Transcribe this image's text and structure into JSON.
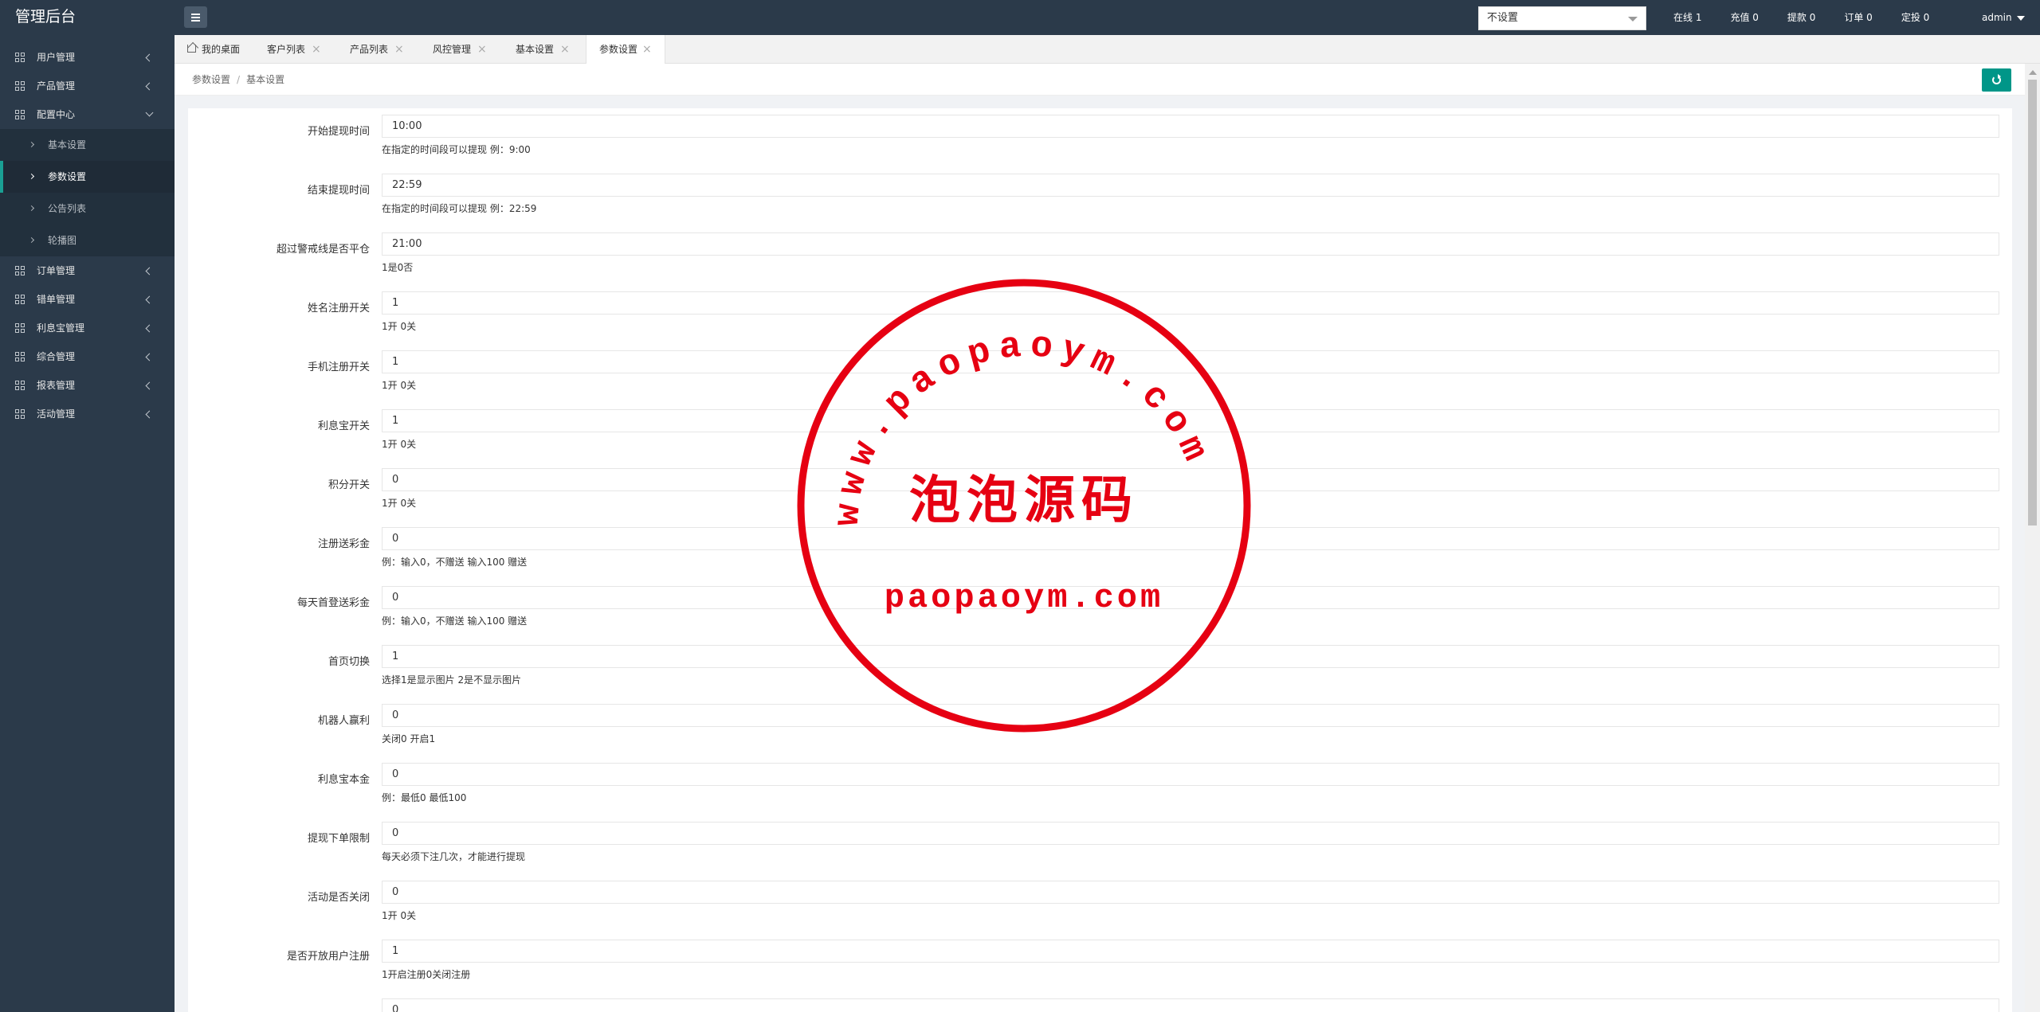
{
  "app": {
    "title": "管理后台"
  },
  "header": {
    "theme_select": {
      "value": "不设置"
    },
    "stats": [
      {
        "label": "在线 1"
      },
      {
        "label": "充值 0"
      },
      {
        "label": "提款 0"
      },
      {
        "label": "订单 0"
      },
      {
        "label": "定投 0"
      }
    ],
    "user": "admin"
  },
  "sidebar": {
    "items": [
      {
        "label": "用户管理"
      },
      {
        "label": "产品管理"
      },
      {
        "label": "配置中心"
      },
      {
        "label": "订单管理"
      },
      {
        "label": "错单管理"
      },
      {
        "label": "利息宝管理"
      },
      {
        "label": "综合管理"
      },
      {
        "label": "报表管理"
      },
      {
        "label": "活动管理"
      }
    ],
    "config_sub": [
      {
        "label": "基本设置"
      },
      {
        "label": "参数设置"
      },
      {
        "label": "公告列表"
      },
      {
        "label": "轮播图"
      }
    ]
  },
  "tabs": [
    {
      "label": "我的桌面"
    },
    {
      "label": "客户列表"
    },
    {
      "label": "产品列表"
    },
    {
      "label": "风控管理"
    },
    {
      "label": "基本设置"
    },
    {
      "label": "参数设置"
    }
  ],
  "breadcrumb": {
    "first": "参数设置",
    "second": "基本设置"
  },
  "form": {
    "fields": [
      {
        "label": "开始提现时间",
        "value": "10:00",
        "tip": "在指定的时间段可以提现 例：9:00"
      },
      {
        "label": "结束提现时间",
        "value": "22:59",
        "tip": "在指定的时间段可以提现 例：22:59"
      },
      {
        "label": "超过警戒线是否平仓",
        "value": "21:00",
        "tip": "1是0否"
      },
      {
        "label": "姓名注册开关",
        "value": "1",
        "tip": "1开 0关"
      },
      {
        "label": "手机注册开关",
        "value": "1",
        "tip": "1开 0关"
      },
      {
        "label": "利息宝开关",
        "value": "1",
        "tip": "1开 0关"
      },
      {
        "label": "积分开关",
        "value": "0",
        "tip": "1开 0关"
      },
      {
        "label": "注册送彩金",
        "value": "0",
        "tip": "例：输入0，不赠送 输入100 赠送"
      },
      {
        "label": "每天首登送彩金",
        "value": "0",
        "tip": "例：输入0，不赠送 输入100 赠送"
      },
      {
        "label": "首页切换",
        "value": "1",
        "tip": "选择1是显示图片 2是不显示图片"
      },
      {
        "label": "机器人赢利",
        "value": "0",
        "tip": "关闭0 开启1"
      },
      {
        "label": "利息宝本金",
        "value": "0",
        "tip": "例：最低0 最低100"
      },
      {
        "label": "提现下单限制",
        "value": "0",
        "tip": "每天必须下注几次，才能进行提现"
      },
      {
        "label": "活动是否关闭",
        "value": "0",
        "tip": "1开 0关"
      },
      {
        "label": "是否开放用户注册",
        "value": "1",
        "tip": "1开启注册0关闭注册"
      },
      {
        "label": "",
        "value": "0",
        "tip": ""
      }
    ]
  },
  "watermark": {
    "arc_text": "www.paopaoym.com",
    "center_text": "泡泡源码",
    "bottom_text": "paopaoym.com",
    "color": "#e60012"
  },
  "colors": {
    "sidebar_bg": "#2b3a4a",
    "accent": "#009688",
    "active_border": "#1aa094"
  }
}
